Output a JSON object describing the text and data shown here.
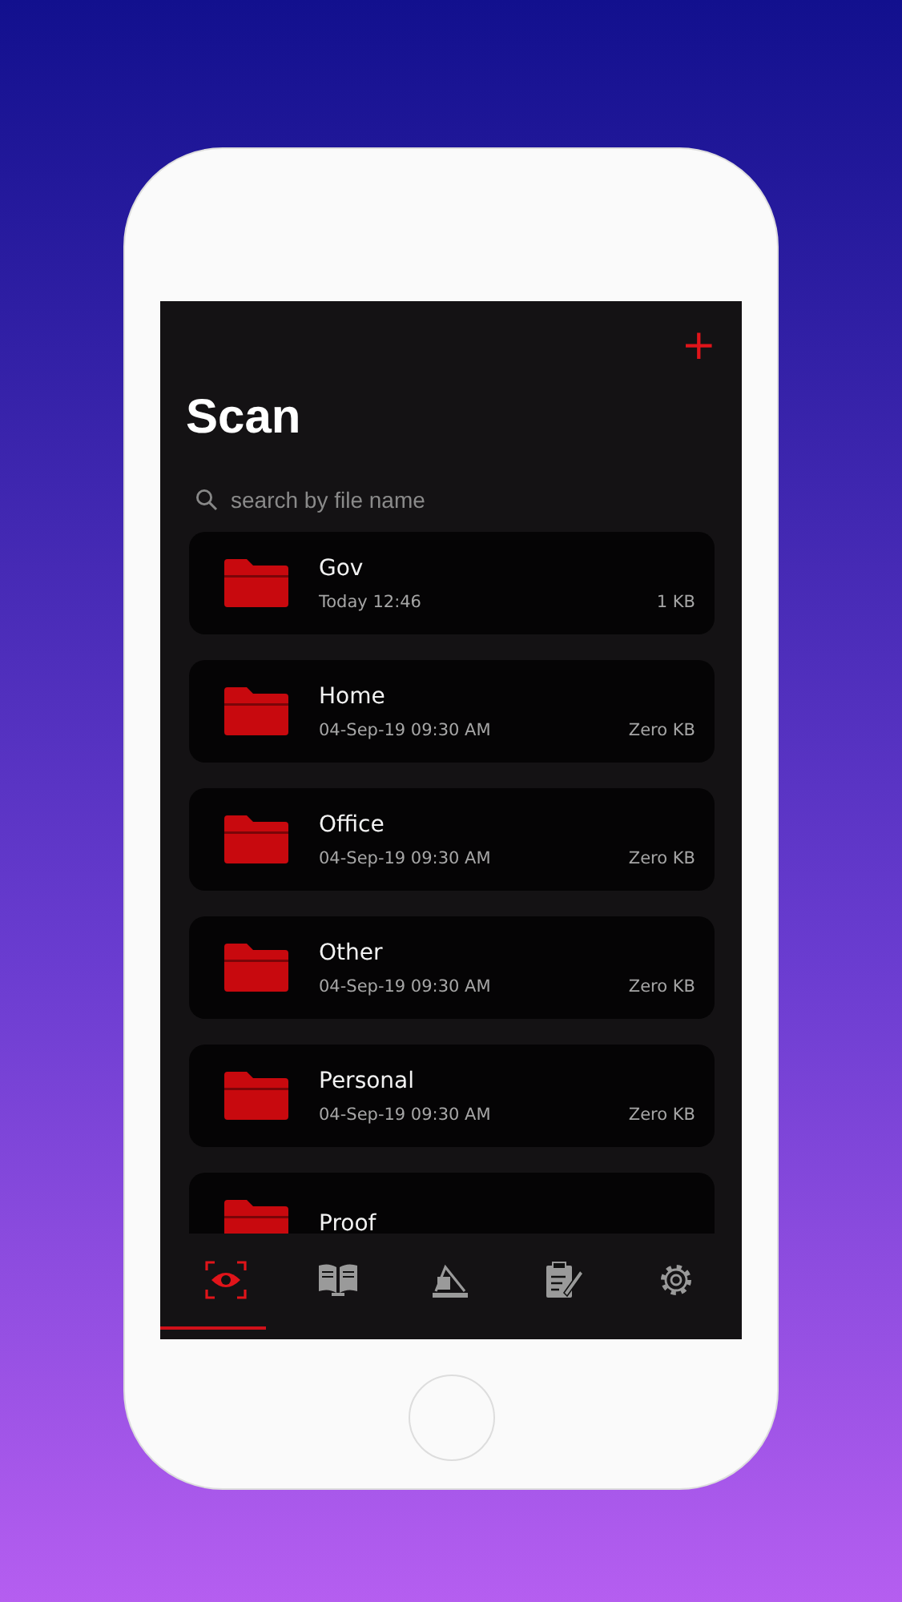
{
  "header": {
    "title": "Scan",
    "add_button": "+"
  },
  "search": {
    "placeholder": "search by file name"
  },
  "folders": [
    {
      "name": "Gov",
      "date": "Today 12:46",
      "size": "1 KB"
    },
    {
      "name": "Home",
      "date": "04-Sep-19 09:30 AM",
      "size": "Zero KB"
    },
    {
      "name": "Office",
      "date": "04-Sep-19 09:30 AM",
      "size": "Zero KB"
    },
    {
      "name": "Other",
      "date": "04-Sep-19 09:30 AM",
      "size": "Zero KB"
    },
    {
      "name": "Personal",
      "date": "04-Sep-19 09:30 AM",
      "size": "Zero KB"
    },
    {
      "name": "Proof"
    }
  ],
  "tabs": [
    {
      "kind": "scan",
      "selected": true
    },
    {
      "kind": "book",
      "selected": false
    },
    {
      "kind": "scanner",
      "selected": false
    },
    {
      "kind": "clipboard",
      "selected": false
    },
    {
      "kind": "settings",
      "selected": false
    }
  ]
}
